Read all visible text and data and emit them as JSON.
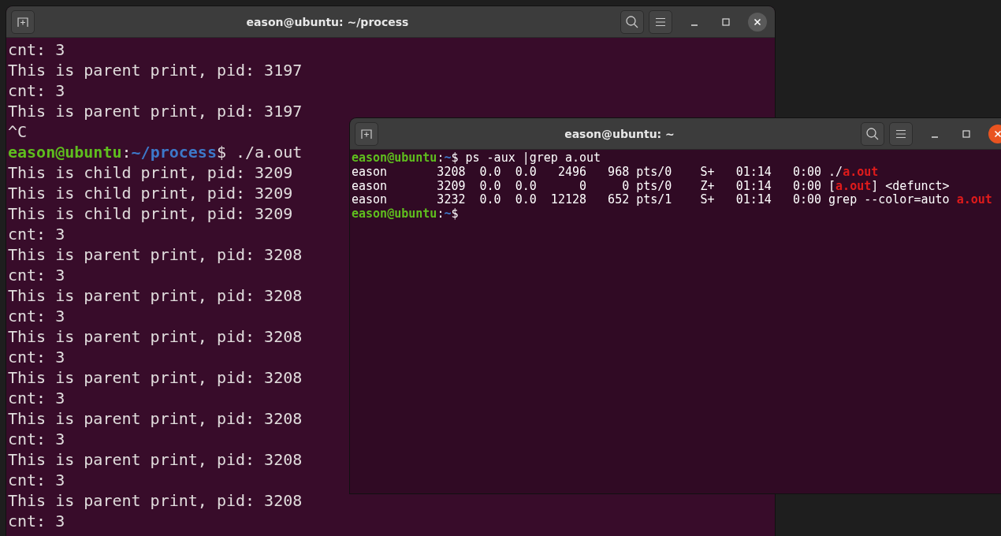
{
  "windows": [
    {
      "title": "eason@ubuntu: ~/process",
      "active": false,
      "lines": [
        [
          {
            "kind": "text",
            "text": "cnt: 3"
          }
        ],
        [
          {
            "kind": "text",
            "text": "This is parent print, pid: 3197"
          }
        ],
        [
          {
            "kind": "text",
            "text": "cnt: 3"
          }
        ],
        [
          {
            "kind": "text",
            "text": "This is parent print, pid: 3197"
          }
        ],
        [
          {
            "kind": "text",
            "text": "^C"
          }
        ],
        [
          {
            "kind": "user",
            "text": "eason@ubuntu"
          },
          {
            "kind": "text",
            "text": ":"
          },
          {
            "kind": "path",
            "text": "~/process"
          },
          {
            "kind": "text",
            "text": "$ ./a.out"
          }
        ],
        [
          {
            "kind": "text",
            "text": "This is child print, pid: 3209"
          }
        ],
        [
          {
            "kind": "text",
            "text": "This is child print, pid: 3209"
          }
        ],
        [
          {
            "kind": "text",
            "text": "This is child print, pid: 3209"
          }
        ],
        [
          {
            "kind": "text",
            "text": "cnt: 3"
          }
        ],
        [
          {
            "kind": "text",
            "text": "This is parent print, pid: 3208"
          }
        ],
        [
          {
            "kind": "text",
            "text": "cnt: 3"
          }
        ],
        [
          {
            "kind": "text",
            "text": "This is parent print, pid: 3208"
          }
        ],
        [
          {
            "kind": "text",
            "text": "cnt: 3"
          }
        ],
        [
          {
            "kind": "text",
            "text": "This is parent print, pid: 3208"
          }
        ],
        [
          {
            "kind": "text",
            "text": "cnt: 3"
          }
        ],
        [
          {
            "kind": "text",
            "text": "This is parent print, pid: 3208"
          }
        ],
        [
          {
            "kind": "text",
            "text": "cnt: 3"
          }
        ],
        [
          {
            "kind": "text",
            "text": "This is parent print, pid: 3208"
          }
        ],
        [
          {
            "kind": "text",
            "text": "cnt: 3"
          }
        ],
        [
          {
            "kind": "text",
            "text": "This is parent print, pid: 3208"
          }
        ],
        [
          {
            "kind": "text",
            "text": "cnt: 3"
          }
        ],
        [
          {
            "kind": "text",
            "text": "This is parent print, pid: 3208"
          }
        ],
        [
          {
            "kind": "text",
            "text": "cnt: 3"
          }
        ]
      ]
    },
    {
      "title": "eason@ubuntu: ~",
      "active": true,
      "lines": [
        [
          {
            "kind": "user",
            "text": "eason@ubuntu"
          },
          {
            "kind": "text",
            "text": ":"
          },
          {
            "kind": "path",
            "text": "~"
          },
          {
            "kind": "text",
            "text": "$ ps -aux |grep a.out"
          }
        ],
        [
          {
            "kind": "text",
            "text": "eason       3208  0.0  0.0   2496   968 pts/0    S+   01:14   0:00 ./"
          },
          {
            "kind": "match",
            "text": "a.out"
          }
        ],
        [
          {
            "kind": "text",
            "text": "eason       3209  0.0  0.0      0     0 pts/0    Z+   01:14   0:00 ["
          },
          {
            "kind": "match",
            "text": "a.out"
          },
          {
            "kind": "text",
            "text": "] <defunct>"
          }
        ],
        [
          {
            "kind": "text",
            "text": "eason       3232  0.0  0.0  12128   652 pts/1    S+   01:14   0:00 grep --color=auto "
          },
          {
            "kind": "match",
            "text": "a.out"
          }
        ],
        [
          {
            "kind": "user",
            "text": "eason@ubuntu"
          },
          {
            "kind": "text",
            "text": ":"
          },
          {
            "kind": "path",
            "text": "~"
          },
          {
            "kind": "text",
            "text": "$"
          }
        ]
      ]
    }
  ]
}
